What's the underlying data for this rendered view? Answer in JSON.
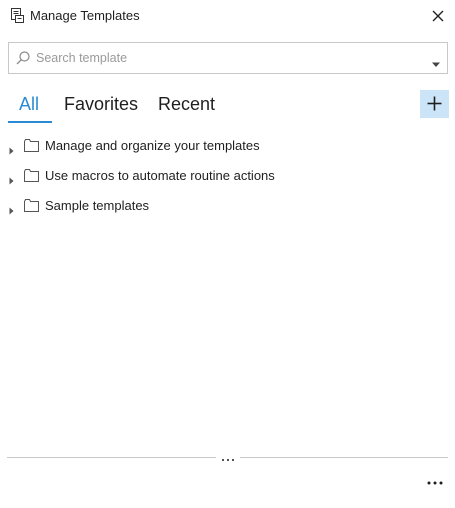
{
  "window": {
    "title": "Manage Templates",
    "title_icon": "templates-icon",
    "close_icon": "close-icon"
  },
  "search": {
    "placeholder": "Search template",
    "value": "",
    "icon": "search-icon",
    "dropdown_icon": "chevron-down-icon"
  },
  "tabs": [
    {
      "label": "All",
      "active": true
    },
    {
      "label": "Favorites",
      "active": false
    },
    {
      "label": "Recent",
      "active": false
    }
  ],
  "add_button": {
    "icon": "plus-icon"
  },
  "tree": [
    {
      "label": "Manage and organize your templates",
      "expanded": false
    },
    {
      "label": "Use macros to automate routine actions",
      "expanded": false
    },
    {
      "label": "Sample templates",
      "expanded": false
    }
  ],
  "footer": {
    "more_icon": "more-options-icon",
    "grip_icon": "splitter-grip-icon"
  },
  "colors": {
    "accent": "#2a8ad4",
    "add_button_bg": "#cce4f7",
    "border": "#c8c8c8"
  }
}
